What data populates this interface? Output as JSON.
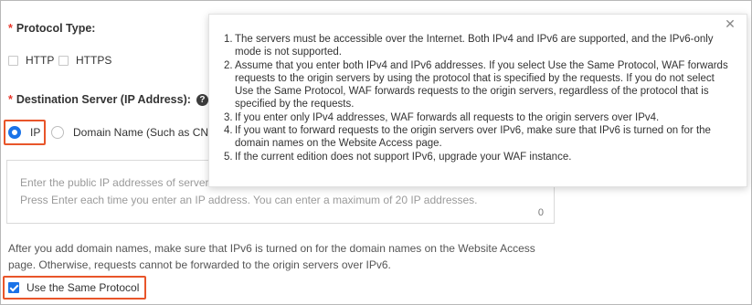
{
  "protocol": {
    "label": "Protocol Type:",
    "required_mark": "*",
    "options": [
      {
        "label": "HTTP",
        "checked": false
      },
      {
        "label": "HTTPS",
        "checked": false
      }
    ]
  },
  "destination": {
    "label": "Destination Server (IP Address):",
    "required_mark": "*",
    "help_icon": "question-circle-icon",
    "help_glyph": "?",
    "options": [
      {
        "label": "IP",
        "selected": true
      },
      {
        "label": "Domain Name (Such as CNA",
        "selected": false
      }
    ]
  },
  "ip_input": {
    "placeholder": "Enter the public IP addresses of servers\nPress Enter each time you enter an IP address. You can enter a maximum of 20 IP addresses.",
    "counter": "0"
  },
  "note": "After you add domain names, make sure that IPv6 is turned on for the domain names on the Website Access page. Otherwise, requests cannot be forwarded to the origin servers over IPv6.",
  "same_protocol": {
    "label": "Use the Same Protocol",
    "checked": true
  },
  "tooltip": {
    "close_glyph": "✕",
    "items": [
      {
        "num": "1.",
        "text": "The servers must be accessible over the Internet. Both IPv4 and IPv6 are supported, and the IPv6-only mode is not supported."
      },
      {
        "num": "2.",
        "text": "Assume that you enter both IPv4 and IPv6 addresses. If you select Use the Same Protocol, WAF forwards requests to the origin servers by using the protocol that is specified by the requests. If you do not select Use the Same Protocol, WAF forwards requests to the origin servers, regardless of the protocol that is specified by the requests."
      },
      {
        "num": "3.",
        "text": "If you enter only IPv4 addresses, WAF forwards all requests to the origin servers over IPv4."
      },
      {
        "num": "4.",
        "text": "If you want to forward requests to the origin servers over IPv6, make sure that IPv6 is turned on for the domain names on the Website Access page."
      },
      {
        "num": "5.",
        "text": "If the current edition does not support IPv6, upgrade your WAF instance."
      }
    ]
  },
  "colors": {
    "accent": "#1a73e8",
    "highlight": "#e8552a",
    "required": "#e8362a"
  }
}
